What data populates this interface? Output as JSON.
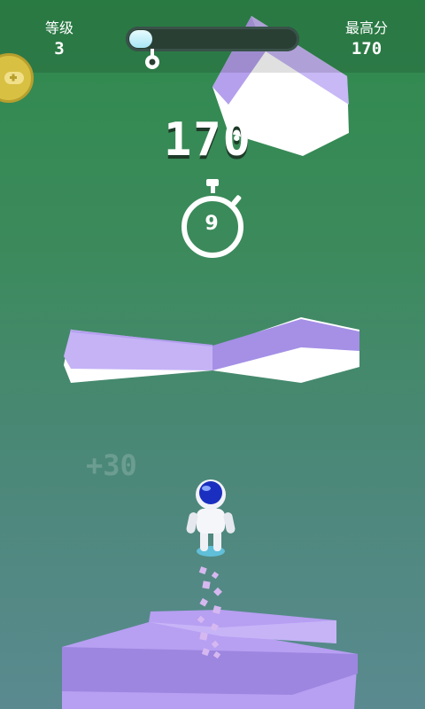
{
  "hud": {
    "level_label": "等级",
    "level_value": "3",
    "best_label": "最高分",
    "best_value": "170",
    "progress_fraction": 0.14
  },
  "game": {
    "score": "170",
    "timer_seconds": "9",
    "bonus_popup": "+30"
  },
  "icons": {
    "side_button": "gamepad-icon",
    "timer": "stopwatch-icon",
    "progress_marker": "pin-marker-icon"
  },
  "colors": {
    "background_top": "#2f8a4c",
    "background_bottom": "#5a8a90",
    "platform_purple": "#b9a4f2",
    "player_helmet": "#1a2fbf"
  }
}
